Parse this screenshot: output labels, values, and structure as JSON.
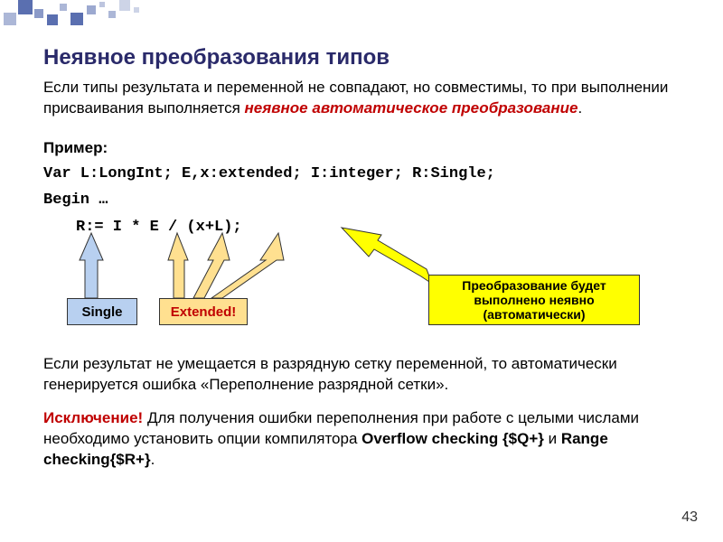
{
  "title": "Неявное преобразования типов",
  "intro": {
    "part1": "Если типы результата и переменной не совпадают, но совместимы, то при выполнении присваивания выполняется ",
    "highlight": "неявное автоматическое преобразование",
    "part2": "."
  },
  "example_label": "Пример:",
  "code": {
    "line1": "Var L:LongInt; E,x:extended; I:integer; R:Single;",
    "line2": "Begin …",
    "line3": "R:= I * E / (x+L);"
  },
  "callouts": {
    "single": "Single",
    "extended": "Extended!",
    "yellow": "Преобразование будет выполнено неявно (автоматически)"
  },
  "para1": "Если результат не умещается в разрядную сетку переменной, то автоматически генерируется ошибка «Переполнение разрядной сетки».",
  "para2": {
    "exc": "Исключение!",
    "rest1": " Для получения ошибки переполнения при работе с целыми числами необходимо установить опции компилятора ",
    "b1": "Overflow checking {$Q+}",
    "mid": " и ",
    "b2": "Range checking{$R+}",
    "end": "."
  },
  "page_number": "43"
}
